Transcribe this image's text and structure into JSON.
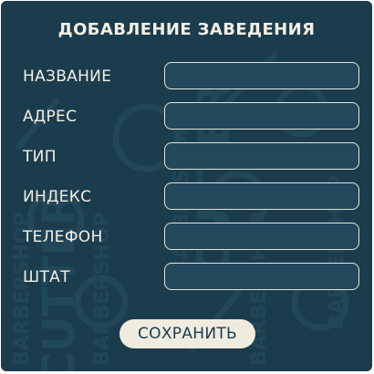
{
  "form": {
    "title": "ДОБАВЛЕНИЕ ЗАВЕДЕНИЯ",
    "fields": [
      {
        "label": "НАЗВАНИЕ",
        "value": "",
        "placeholder": ""
      },
      {
        "label": "АДРЕС",
        "value": "",
        "placeholder": ""
      },
      {
        "label": "ТИП",
        "value": "",
        "placeholder": ""
      },
      {
        "label": "ИНДЕКС",
        "value": "",
        "placeholder": ""
      },
      {
        "label": "ТЕЛЕФОН",
        "value": "",
        "placeholder": ""
      },
      {
        "label": "ШТАТ",
        "value": "",
        "placeholder": ""
      }
    ],
    "save_label": "СОХРАНИТЬ"
  },
  "background": {
    "watermark_text": "BARBERSHOP",
    "watermark_letters": "CUTTER"
  },
  "colors": {
    "panel": "#1b3c4d",
    "field_fill": "#21495b",
    "field_border": "#e8e4d8",
    "text": "#f4f0e4",
    "button": "#efecdf",
    "button_text": "#1b3c4d"
  }
}
